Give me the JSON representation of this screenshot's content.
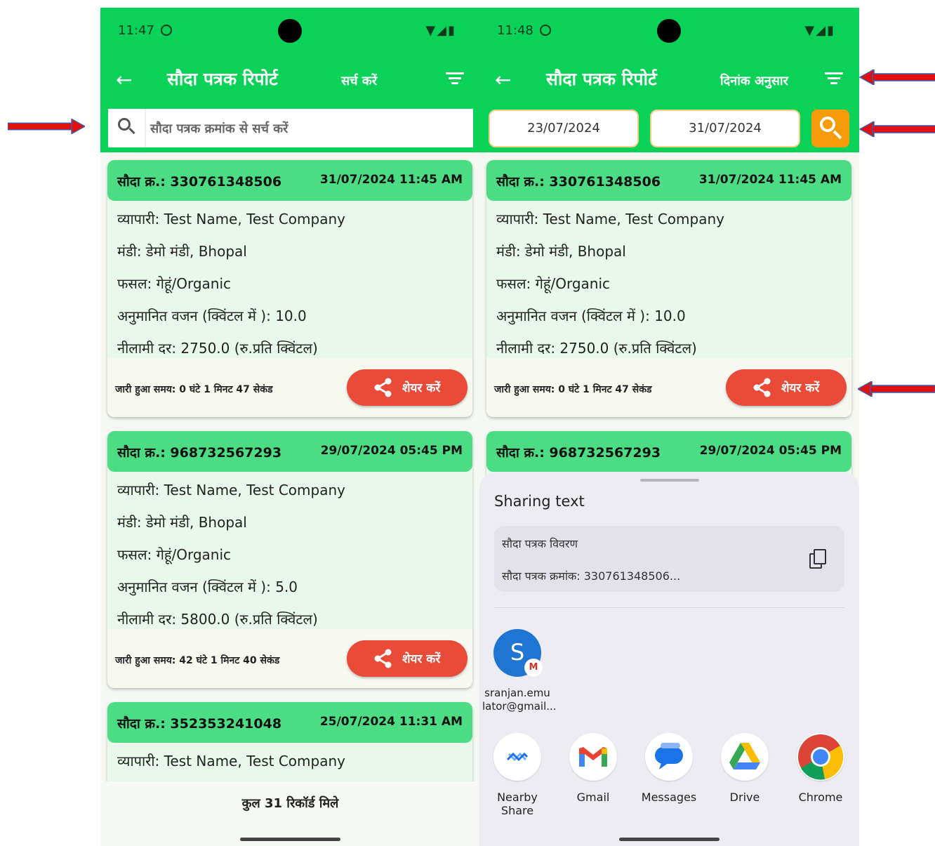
{
  "colors": {
    "appbar": "#0ad157",
    "card_header": "#4cdd84",
    "card_body": "#e8f8ea",
    "share_button": "#ea4a38",
    "date_search_button": "#f89b08",
    "annotation_arrow": "#e01010"
  },
  "left": {
    "status": {
      "time": "11:47"
    },
    "appbar": {
      "title": "सौदा पत्रक रिपोर्ट",
      "action": "सर्च करें"
    },
    "search": {
      "placeholder": "सौदा पत्रक क्रमांक से सर्च करें"
    },
    "cards": [
      {
        "number": "सौदा क्र.: 330761348506",
        "date": "31/07/2024 11:45 AM",
        "lines": [
          "व्यापारी: Test Name, Test Company",
          "मंडी: डेमो मंडी, Bhopal",
          "फसल: गेहूं/Organic",
          "अनुमानित वजन (क्विंटल में ): 10.0",
          "नीलामी दर: 2750.0 (रु.प्रति क्विंटल)"
        ],
        "elapsed": "जारी हुआ समय: 0 घंटे 1 मिनट 47 सेकंड",
        "share": "शेयर करें"
      },
      {
        "number": "सौदा क्र.: 968732567293",
        "date": "29/07/2024 05:45 PM",
        "lines": [
          "व्यापारी: Test Name, Test Company",
          "मंडी: डेमो मंडी, Bhopal",
          "फसल: गेहूं/Organic",
          "अनुमानित वजन (क्विंटल में ): 5.0",
          "नीलामी दर: 5800.0 (रु.प्रति क्विंटल)"
        ],
        "elapsed": "जारी हुआ समय: 42 घंटे 1 मिनट 40 सेकंड",
        "share": "शेयर करें"
      },
      {
        "number": "सौदा क्र.: 352353241048",
        "date": "25/07/2024 11:31 AM",
        "lines": [
          "व्यापारी: Test Name, Test Company"
        ]
      }
    ],
    "total": "कुल 31 रिकॉर्ड मिले"
  },
  "right": {
    "status": {
      "time": "11:48"
    },
    "appbar": {
      "title": "सौदा पत्रक रिपोर्ट",
      "action": "दिनांक अनुसार"
    },
    "date_from": "23/07/2024",
    "date_to": "31/07/2024",
    "cards": [
      {
        "number": "सौदा क्र.: 330761348506",
        "date": "31/07/2024 11:45 AM",
        "lines": [
          "व्यापारी: Test Name, Test Company",
          "मंडी: डेमो मंडी, Bhopal",
          "फसल: गेहूं/Organic",
          "अनुमानित वजन (क्विंटल में ): 10.0",
          "नीलामी दर: 2750.0 (रु.प्रति क्विंटल)"
        ],
        "elapsed": "जारी हुआ समय: 0 घंटे 1 मिनट 47 सेकंड",
        "share": "शेयर करें"
      },
      {
        "number": "सौदा क्र.: 968732567293",
        "date": "29/07/2024 05:45 PM"
      }
    ],
    "share_sheet": {
      "title": "Sharing text",
      "preview_line1": "सौदा पत्रक विवरण",
      "preview_line2": "सौदा पत्रक क्रमांक: 330761348506...",
      "contact": {
        "initial": "S",
        "name_line1": "sranjan.emu",
        "name_line2": "lator@gmail..."
      },
      "apps": [
        "Nearby Share",
        "Gmail",
        "Messages",
        "Drive",
        "Chrome"
      ]
    }
  }
}
